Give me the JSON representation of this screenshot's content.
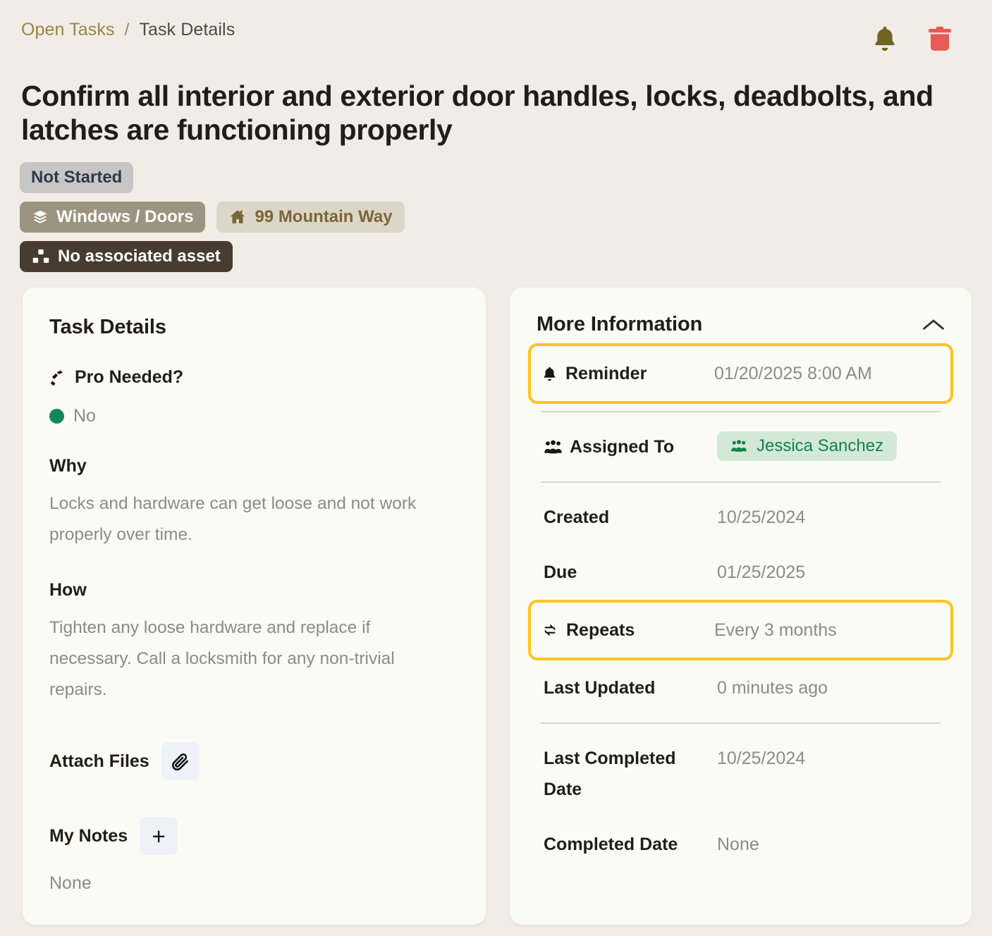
{
  "breadcrumb": {
    "root": "Open Tasks",
    "separator": "/",
    "current": "Task Details"
  },
  "header_icons": {
    "bell": "bell-icon",
    "trash": "trash-icon",
    "bell_color": "#6f6424",
    "trash_color": "#e75a55"
  },
  "task": {
    "title": "Confirm all interior and exterior door handles, locks, deadbolts, and latches are functioning properly",
    "status_badge": "Not Started",
    "category_badge": "Windows / Doors",
    "address_badge": "99 Mountain Way",
    "asset_badge": "No associated asset"
  },
  "left_card": {
    "heading": "Task Details",
    "pro_needed_label": "Pro Needed?",
    "pro_needed_value": "No",
    "pro_needed_dot_color": "#14875a",
    "why_heading": "Why",
    "why_body": "Locks and hardware can get loose and not work properly over time.",
    "how_heading": "How",
    "how_body": "Tighten any loose hardware and replace if necessary. Call a locksmith for any non-trivial repairs.",
    "attach_files_label": "Attach Files",
    "my_notes_label": "My Notes",
    "my_notes_value": "None",
    "add_note_glyph": "+"
  },
  "right_card": {
    "heading": "More Information",
    "collapse_icon": "chevron-up-icon",
    "highlight_color": "#ffc51c",
    "rows": [
      {
        "label": "Reminder",
        "value": "01/20/2025 8:00 AM",
        "icon": "bell-icon",
        "highlighted": true
      },
      {
        "label": "Assigned To",
        "value": "Jessica Sanchez",
        "icon": "people-icon",
        "highlighted": false
      },
      {
        "label": "Created",
        "value": "10/25/2024",
        "icon": null,
        "highlighted": false
      },
      {
        "label": "Due",
        "value": "01/25/2025",
        "icon": null,
        "highlighted": false
      },
      {
        "label": "Repeats",
        "value": "Every 3 months",
        "icon": "repeat-icon",
        "highlighted": true
      },
      {
        "label": "Last Updated",
        "value": "0 minutes ago",
        "icon": null,
        "highlighted": false
      },
      {
        "label": "Last Completed Date",
        "value": "10/25/2024",
        "icon": null,
        "highlighted": false
      },
      {
        "label": "Completed Date",
        "value": "None",
        "icon": null,
        "highlighted": false
      }
    ]
  }
}
